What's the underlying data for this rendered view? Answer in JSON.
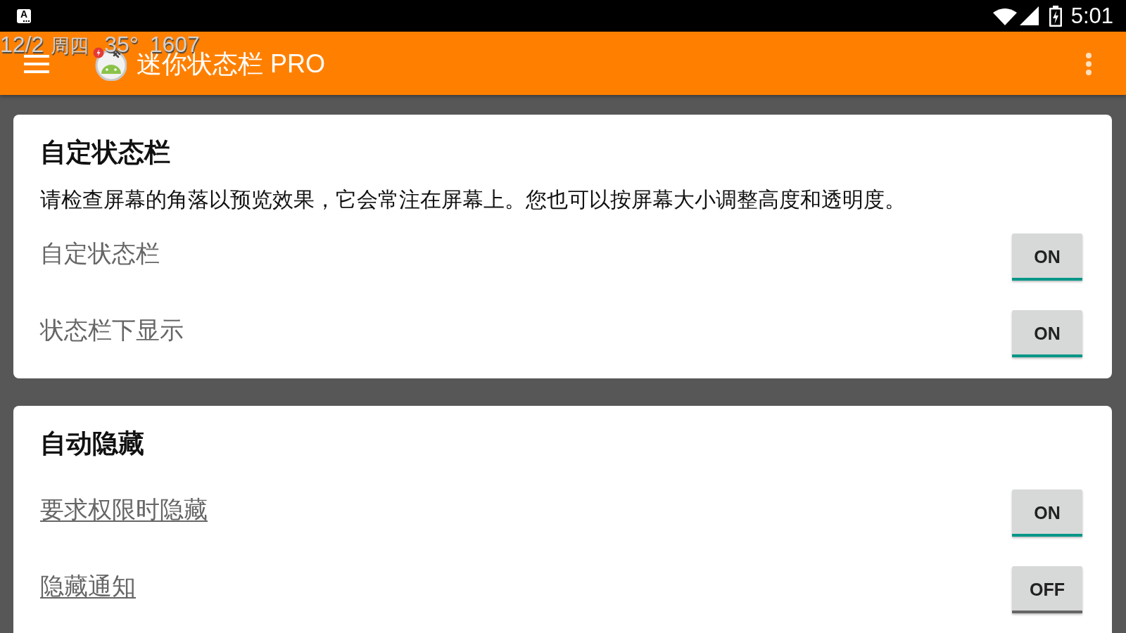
{
  "status_bar": {
    "notification_glyph": "A",
    "time": "5:01"
  },
  "mini_status_overlay": {
    "items": [
      "12/2",
      "周四",
      "35°",
      "1607"
    ]
  },
  "app_bar": {
    "title": "迷你状态栏 PRO"
  },
  "sections": [
    {
      "title": "自定状态栏",
      "description": "请检查屏幕的角落以预览效果，它会常注在屏幕上。您也可以按屏幕大小调整高度和透明度。",
      "settings": [
        {
          "label": "自定状态栏",
          "kind": "plain",
          "button": "ON",
          "on": true
        },
        {
          "label": "状态栏下显示",
          "kind": "plain",
          "button": "ON",
          "on": true
        }
      ]
    },
    {
      "title": "自动隐藏",
      "settings": [
        {
          "label": "要求权限时隐藏",
          "kind": "link",
          "button": "ON",
          "on": true
        },
        {
          "label": "隐藏通知",
          "kind": "link",
          "button": "OFF",
          "on": false
        }
      ]
    }
  ]
}
